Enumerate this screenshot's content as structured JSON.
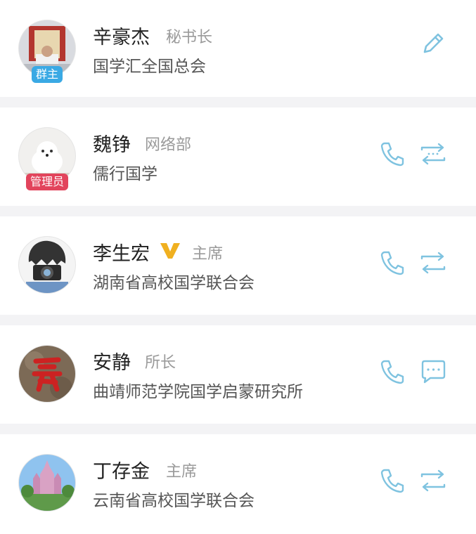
{
  "members": [
    {
      "name": "辛豪杰",
      "role": "秘书长",
      "org": "国学汇全国总会",
      "badge": "群主",
      "actions": [
        "edit-icon"
      ]
    },
    {
      "name": "魏铮",
      "role": "网络部",
      "org": "儒行国学",
      "badge": "管理员",
      "actions": [
        "phone-icon",
        "transfer-icon"
      ]
    },
    {
      "name": "李生宏",
      "role": "主席",
      "org": "湖南省高校国学联合会",
      "verified": true,
      "actions": [
        "phone-icon",
        "transfer-icon"
      ]
    },
    {
      "name": "安静",
      "role": "所长",
      "org": "曲靖师范学院国学启蒙研究所",
      "actions": [
        "phone-icon",
        "message-icon"
      ]
    },
    {
      "name": "丁存金",
      "role": "主席",
      "org": "云南省高校国学联合会",
      "actions": [
        "phone-icon",
        "transfer-icon"
      ]
    }
  ],
  "colors": {
    "icon": "#7fc3e0",
    "owner_badge": "#3aa9e4",
    "admin_badge": "#e2445c",
    "verified": "#f0b020"
  }
}
